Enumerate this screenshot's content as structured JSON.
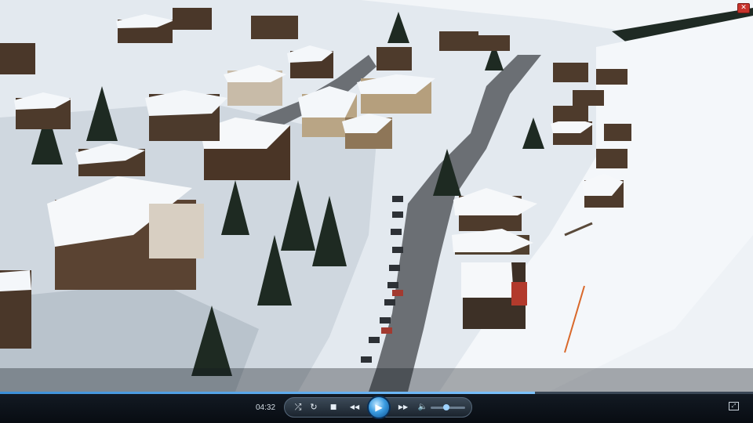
{
  "player": {
    "close_icon": "close-icon",
    "close_glyph": "✕",
    "time_elapsed": "04:32",
    "progress": 0.71,
    "volume": 0.45,
    "buttons": {
      "shuffle": "⤮",
      "repeat": "↻",
      "stop": "■",
      "previous": "◀◀",
      "play": "▶",
      "next": "▶▶",
      "volume": "🔈",
      "fullscreen": "⤢"
    },
    "accent_color": "#3b8fd8"
  }
}
